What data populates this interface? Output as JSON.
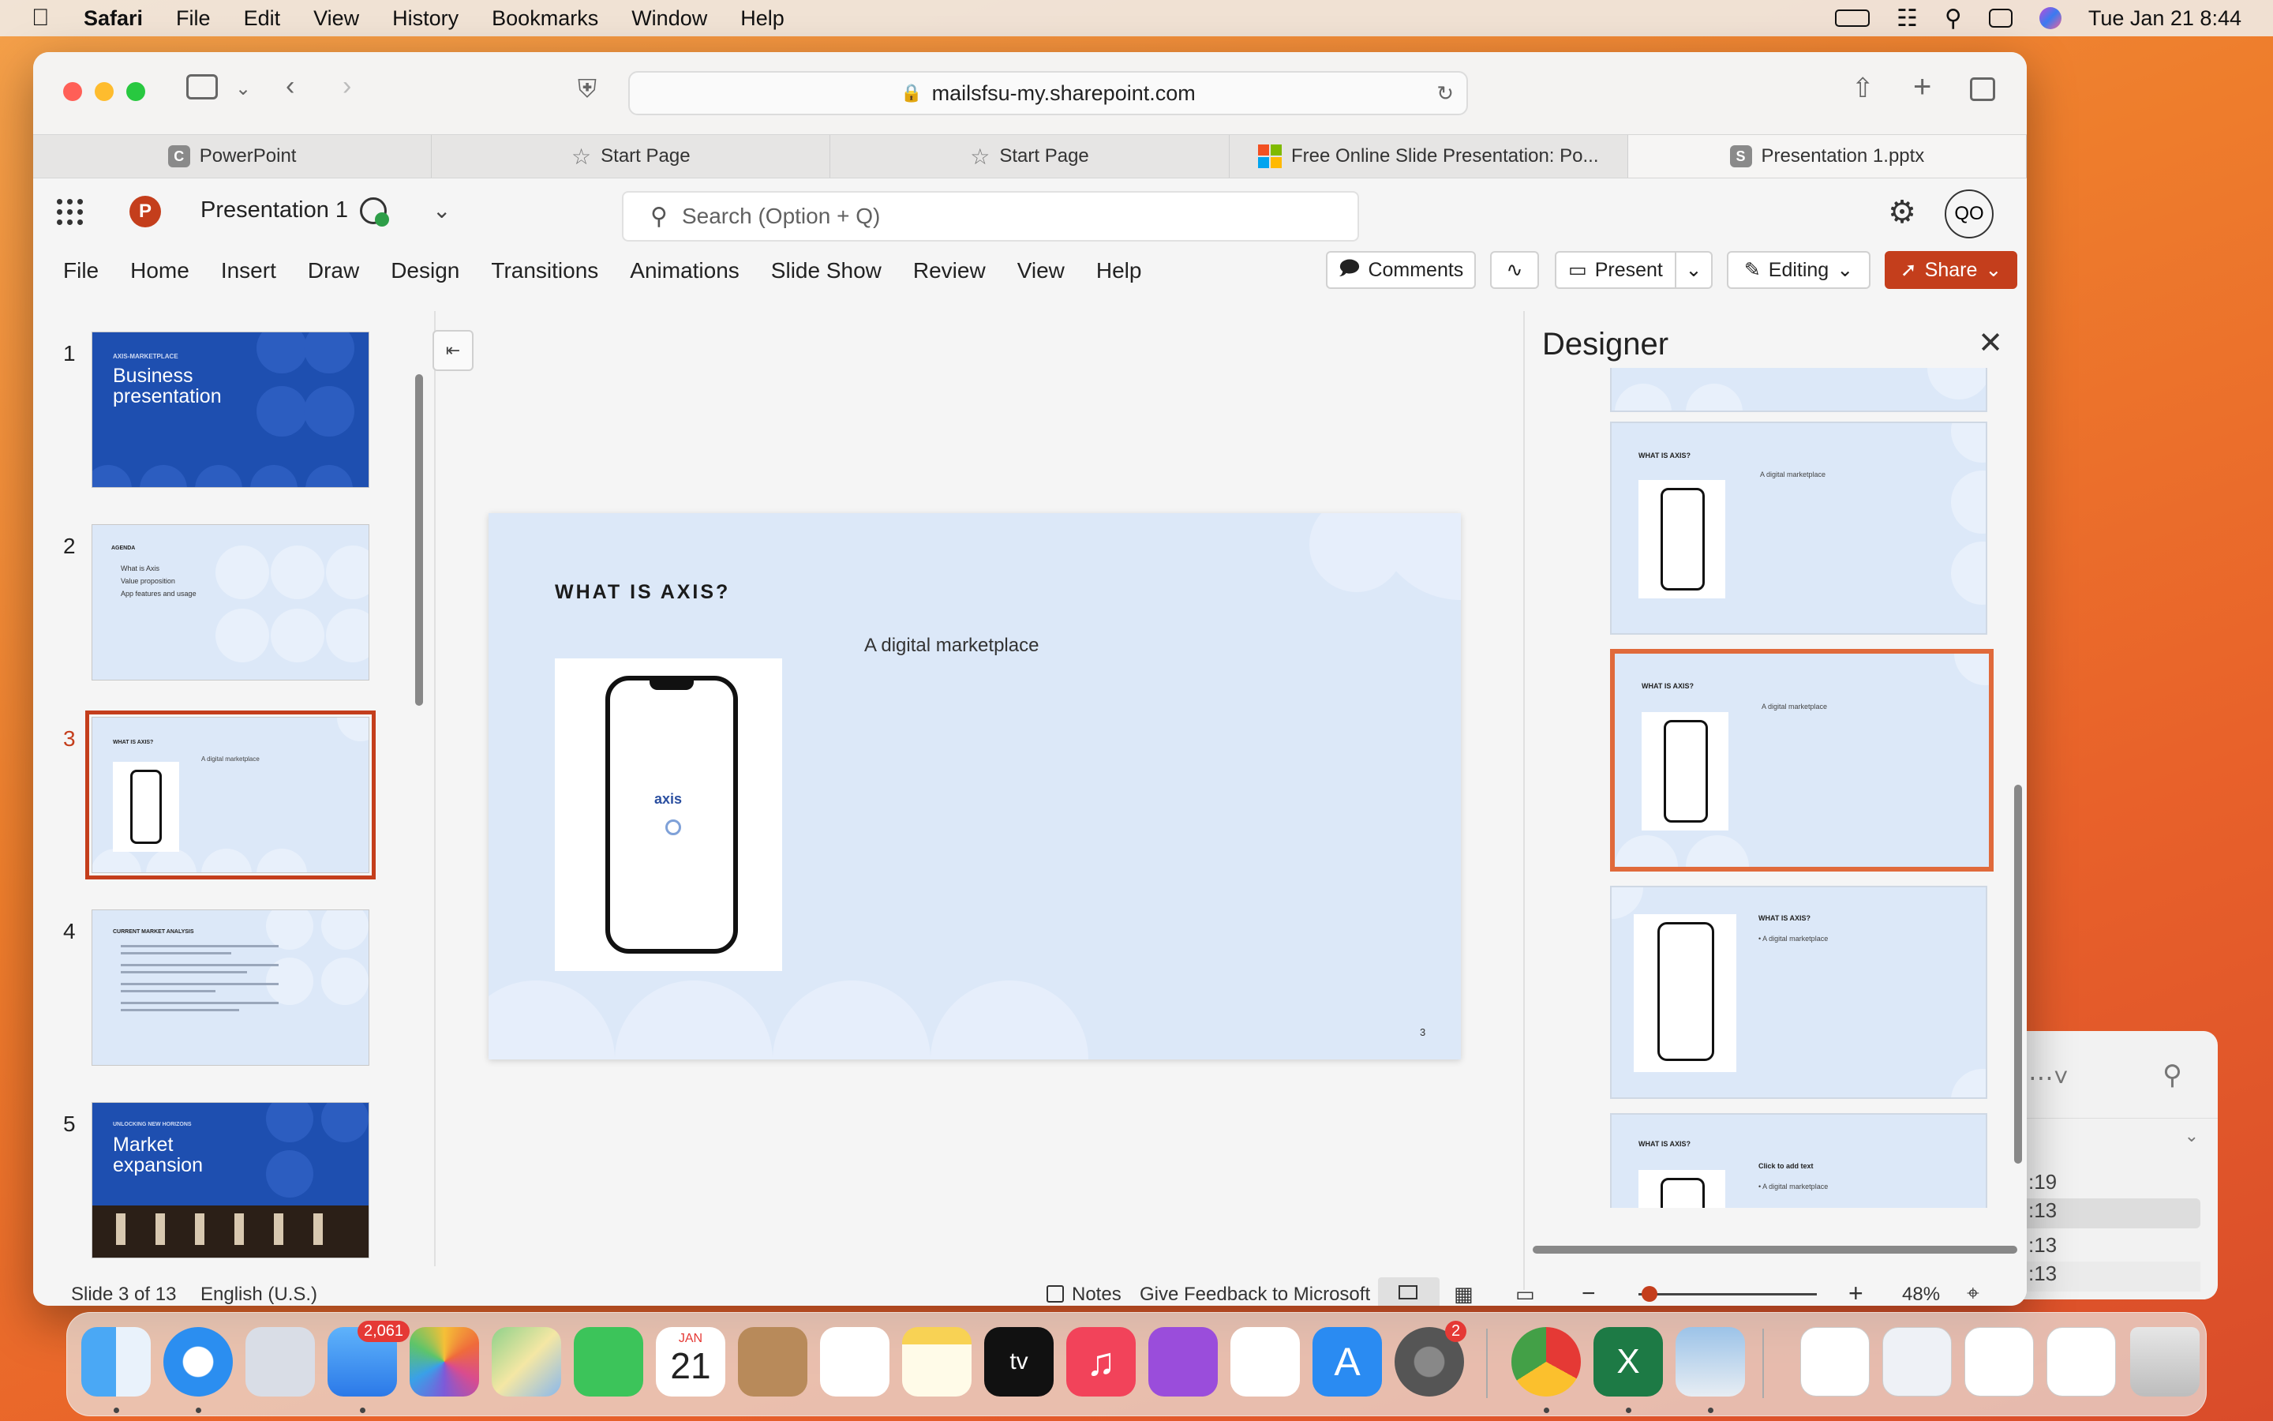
{
  "menubar": {
    "app": "Safari",
    "items": [
      "File",
      "Edit",
      "View",
      "History",
      "Bookmarks",
      "Window",
      "Help"
    ],
    "datetime": "Tue Jan 21  8:44"
  },
  "browser": {
    "url": "mailsfsu-my.sharepoint.com",
    "tabs": [
      {
        "label": "PowerPoint",
        "favicon": "C"
      },
      {
        "label": "Start Page",
        "favicon": "star"
      },
      {
        "label": "Start Page",
        "favicon": "star"
      },
      {
        "label": "Free Online Slide Presentation: Po...",
        "favicon": "ms"
      },
      {
        "label": "Presentation 1.pptx",
        "favicon": "S"
      }
    ]
  },
  "app": {
    "doc_name": "Presentation 1",
    "search_placeholder": "Search (Option + Q)",
    "avatar": "QO",
    "ribbon_tabs": [
      "File",
      "Home",
      "Insert",
      "Draw",
      "Design",
      "Transitions",
      "Animations",
      "Slide Show",
      "Review",
      "View",
      "Help"
    ],
    "comments": "Comments",
    "present": "Present",
    "editing": "Editing",
    "share": "Share"
  },
  "thumbnails": [
    {
      "num": "1",
      "kicker": "AXIS-MARKETPLACE",
      "title": "Business presentation"
    },
    {
      "num": "2",
      "kicker": "AGENDA",
      "bullets": [
        "What is Axis",
        "Value proposition",
        "App features and usage"
      ]
    },
    {
      "num": "3",
      "kicker": "WHAT IS AXIS?",
      "text": "A digital marketplace"
    },
    {
      "num": "4",
      "kicker": "CURRENT MARKET ANALYSIS"
    },
    {
      "num": "5",
      "kicker": "UNLOCKING NEW HORIZONS",
      "title": "Market expansion"
    }
  ],
  "slide": {
    "title": "WHAT IS AXIS?",
    "subtitle": "A digital marketplace",
    "logo": "axis",
    "page": "3"
  },
  "designer": {
    "title": "Designer",
    "cards": [
      {
        "title": "WHAT IS AXIS?",
        "text": "A digital marketplace"
      },
      {
        "title": "WHAT IS AXIS?",
        "text": "A digital marketplace"
      },
      {
        "title": "WHAT IS AXIS?",
        "text": "• A digital marketplace"
      },
      {
        "title": "WHAT IS AXIS?",
        "text": "Click to add text",
        "text2": "• A digital marketplace"
      }
    ]
  },
  "status": {
    "slide_info": "Slide 3 of 13",
    "language": "English (U.S.)",
    "notes": "Notes",
    "feedback": "Give Feedback to Microsoft",
    "zoom": "48%"
  },
  "finder": {
    "times": [
      ":19",
      ":13",
      ":13",
      ":13"
    ]
  },
  "dock": {
    "mail_badge": "2,061",
    "settings_badge": "2",
    "calendar_month": "JAN",
    "calendar_day": "21"
  },
  "colors": {
    "accent": "#c43e1c",
    "slide_bg": "#dce8f8",
    "designer_sel": "#e06a3b"
  }
}
